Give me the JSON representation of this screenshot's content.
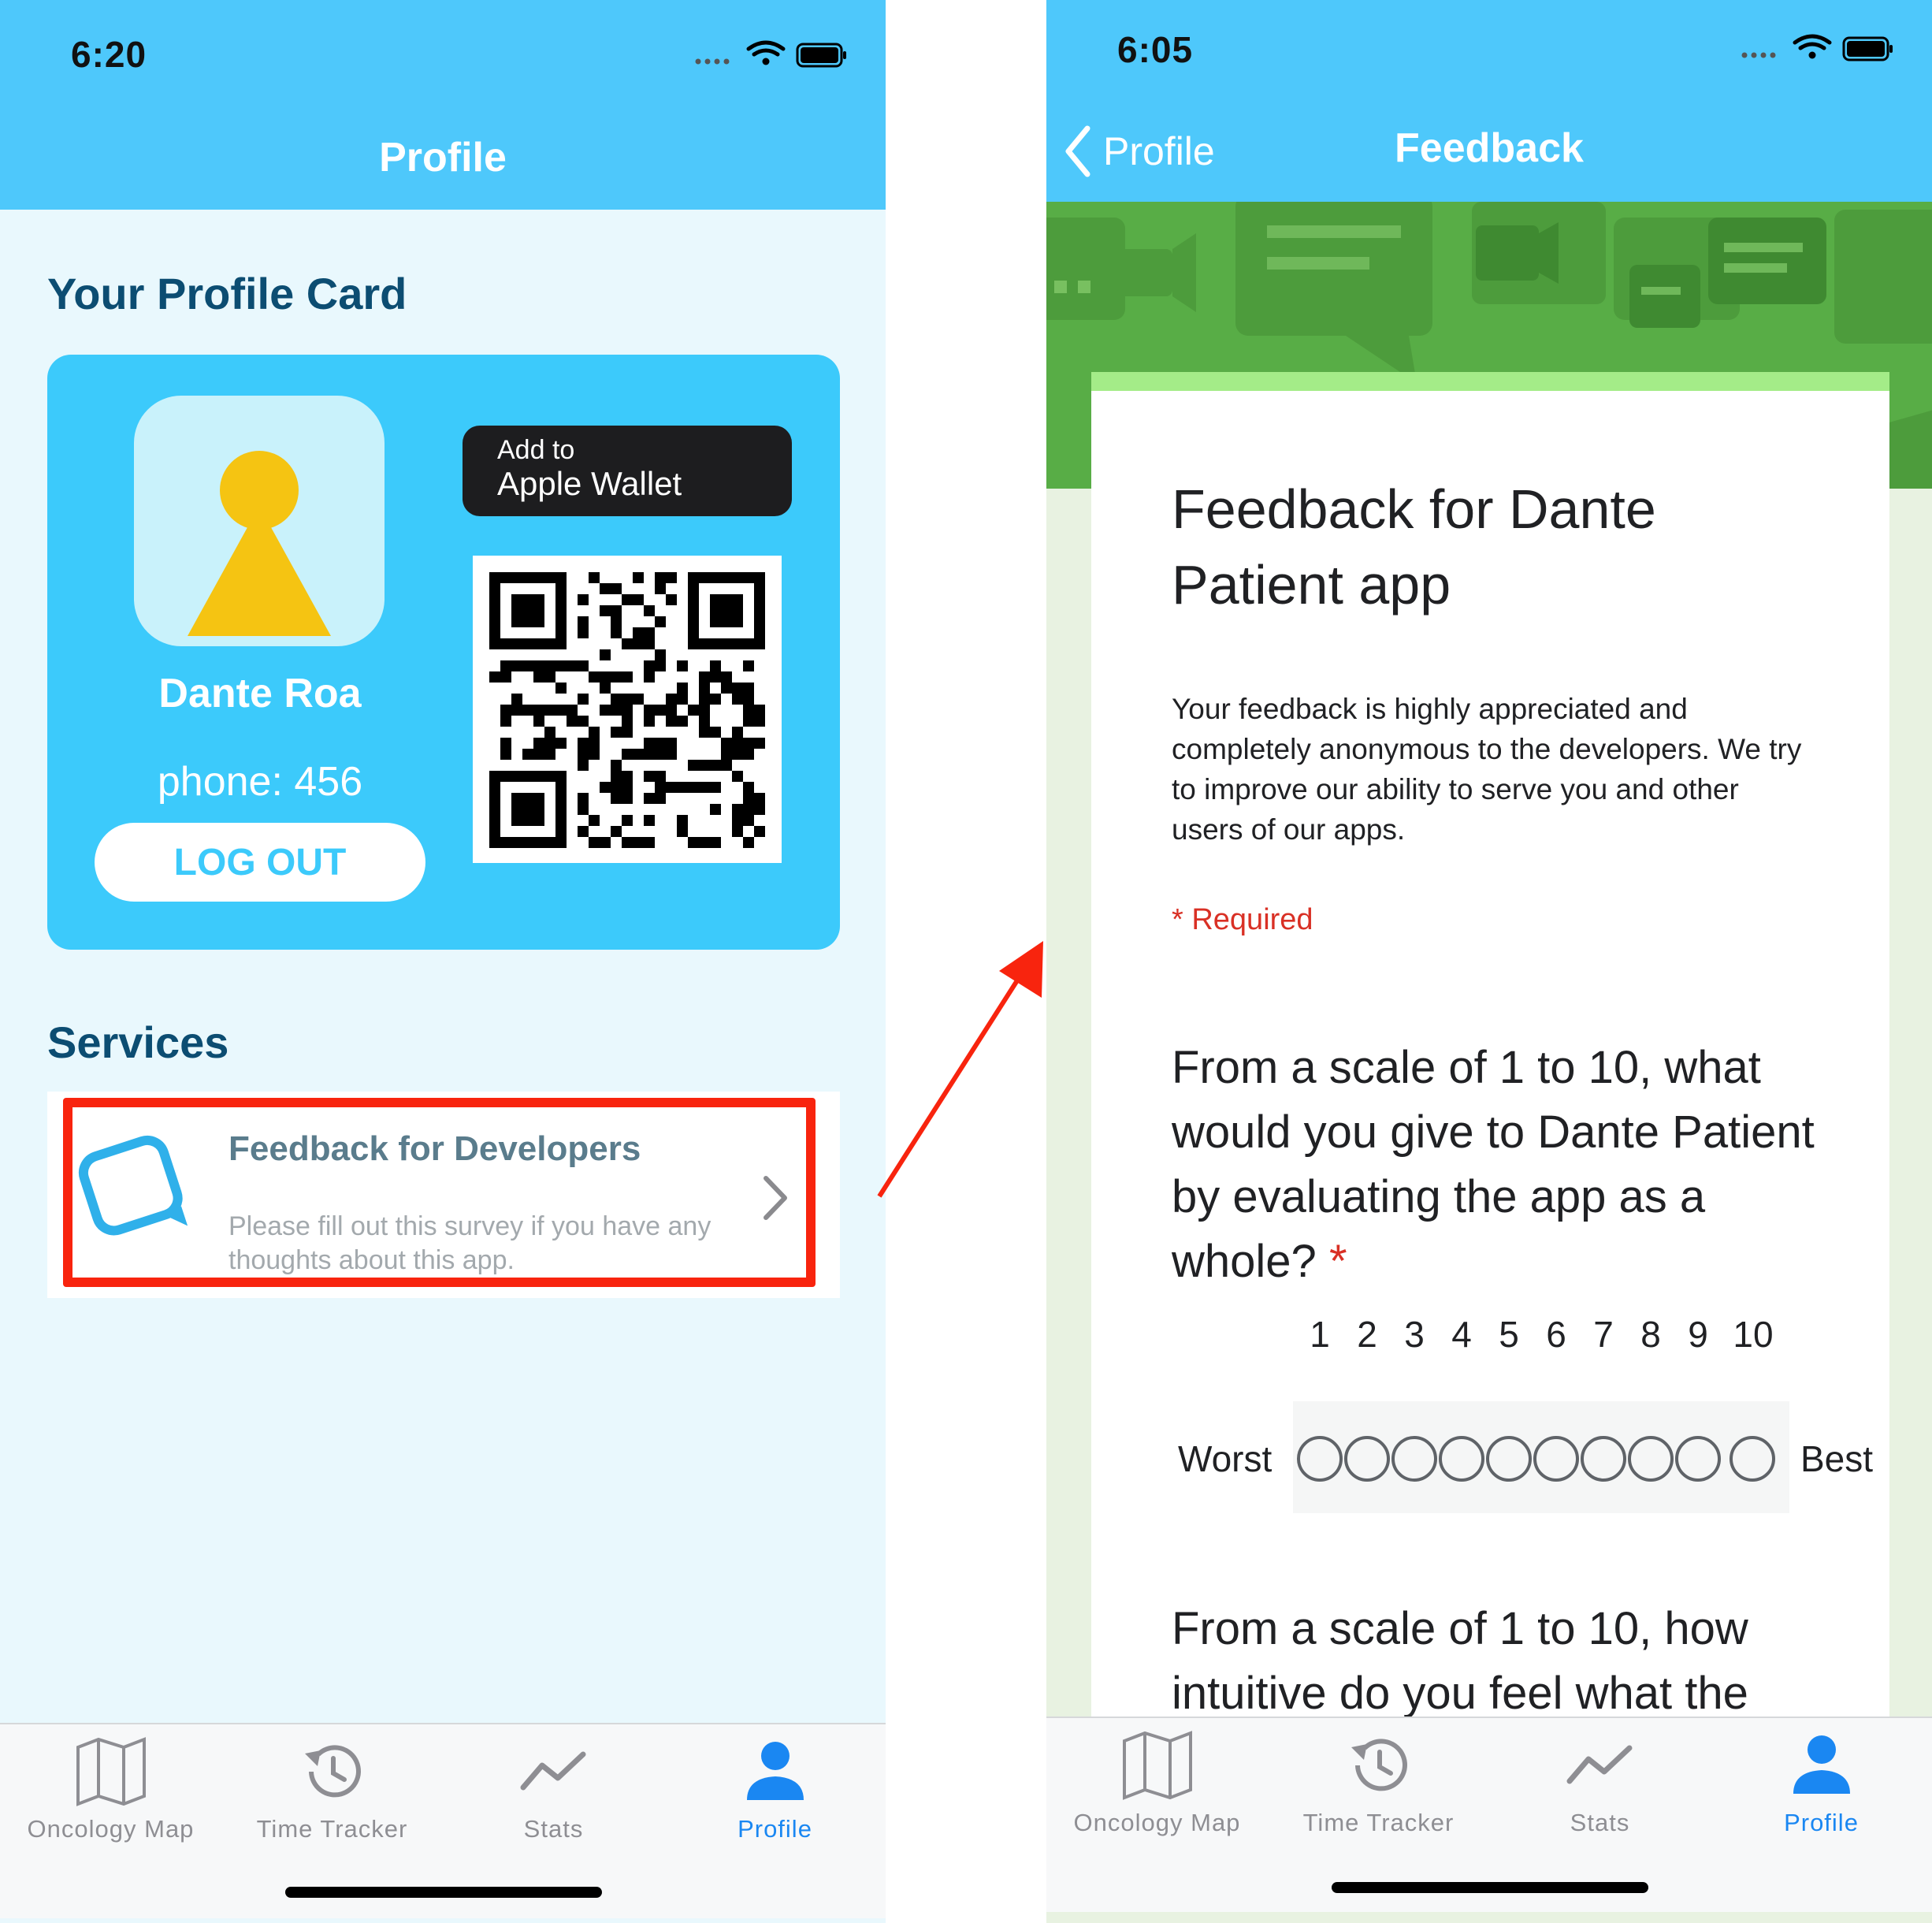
{
  "left": {
    "time": "6:20",
    "nav_title": "Profile",
    "profile_section_title": "Your Profile Card",
    "card": {
      "name": "Dante Roa",
      "phone": "phone: 456",
      "logout_label": "LOG OUT",
      "wallet_small": "Add to",
      "wallet_big": "Apple Wallet"
    },
    "services_title": "Services",
    "service": {
      "title": "Feedback for Developers",
      "description": "Please fill out this survey if you have any thoughts about this app."
    }
  },
  "right": {
    "time": "6:05",
    "back_label": "Profile",
    "nav_title": "Feedback",
    "form": {
      "title": "Feedback for Dante Patient app",
      "description": "Your feedback is highly appreciated and completely anonymous to the developers. We try to improve our ability to serve you and other users of our apps.",
      "required_note": "* Required",
      "question1": "From a scale of 1 to 10, what would you give to Dante Patient by evaluating the app as a whole?",
      "question1_star": "*",
      "scale": [
        "1",
        "2",
        "3",
        "4",
        "5",
        "6",
        "7",
        "8",
        "9",
        "10"
      ],
      "scale_low": "Worst",
      "scale_high": "Best",
      "question2": "From a scale of 1 to 10, how intuitive do you feel what the"
    }
  },
  "tabbar": {
    "tabs": [
      {
        "label": "Oncology Map",
        "icon": "map-icon"
      },
      {
        "label": "Time Tracker",
        "icon": "history-icon"
      },
      {
        "label": "Stats",
        "icon": "stats-icon"
      },
      {
        "label": "Profile",
        "icon": "person-icon"
      }
    ],
    "active_index": 3
  },
  "colors": {
    "nav_bar": "#4ec8fb",
    "card": "#3ccafb",
    "section_title": "#0c4d72",
    "highlight": "#f8240e",
    "tab_active": "#1a87f2",
    "required": "#d93025",
    "banner": "#58ad46"
  }
}
